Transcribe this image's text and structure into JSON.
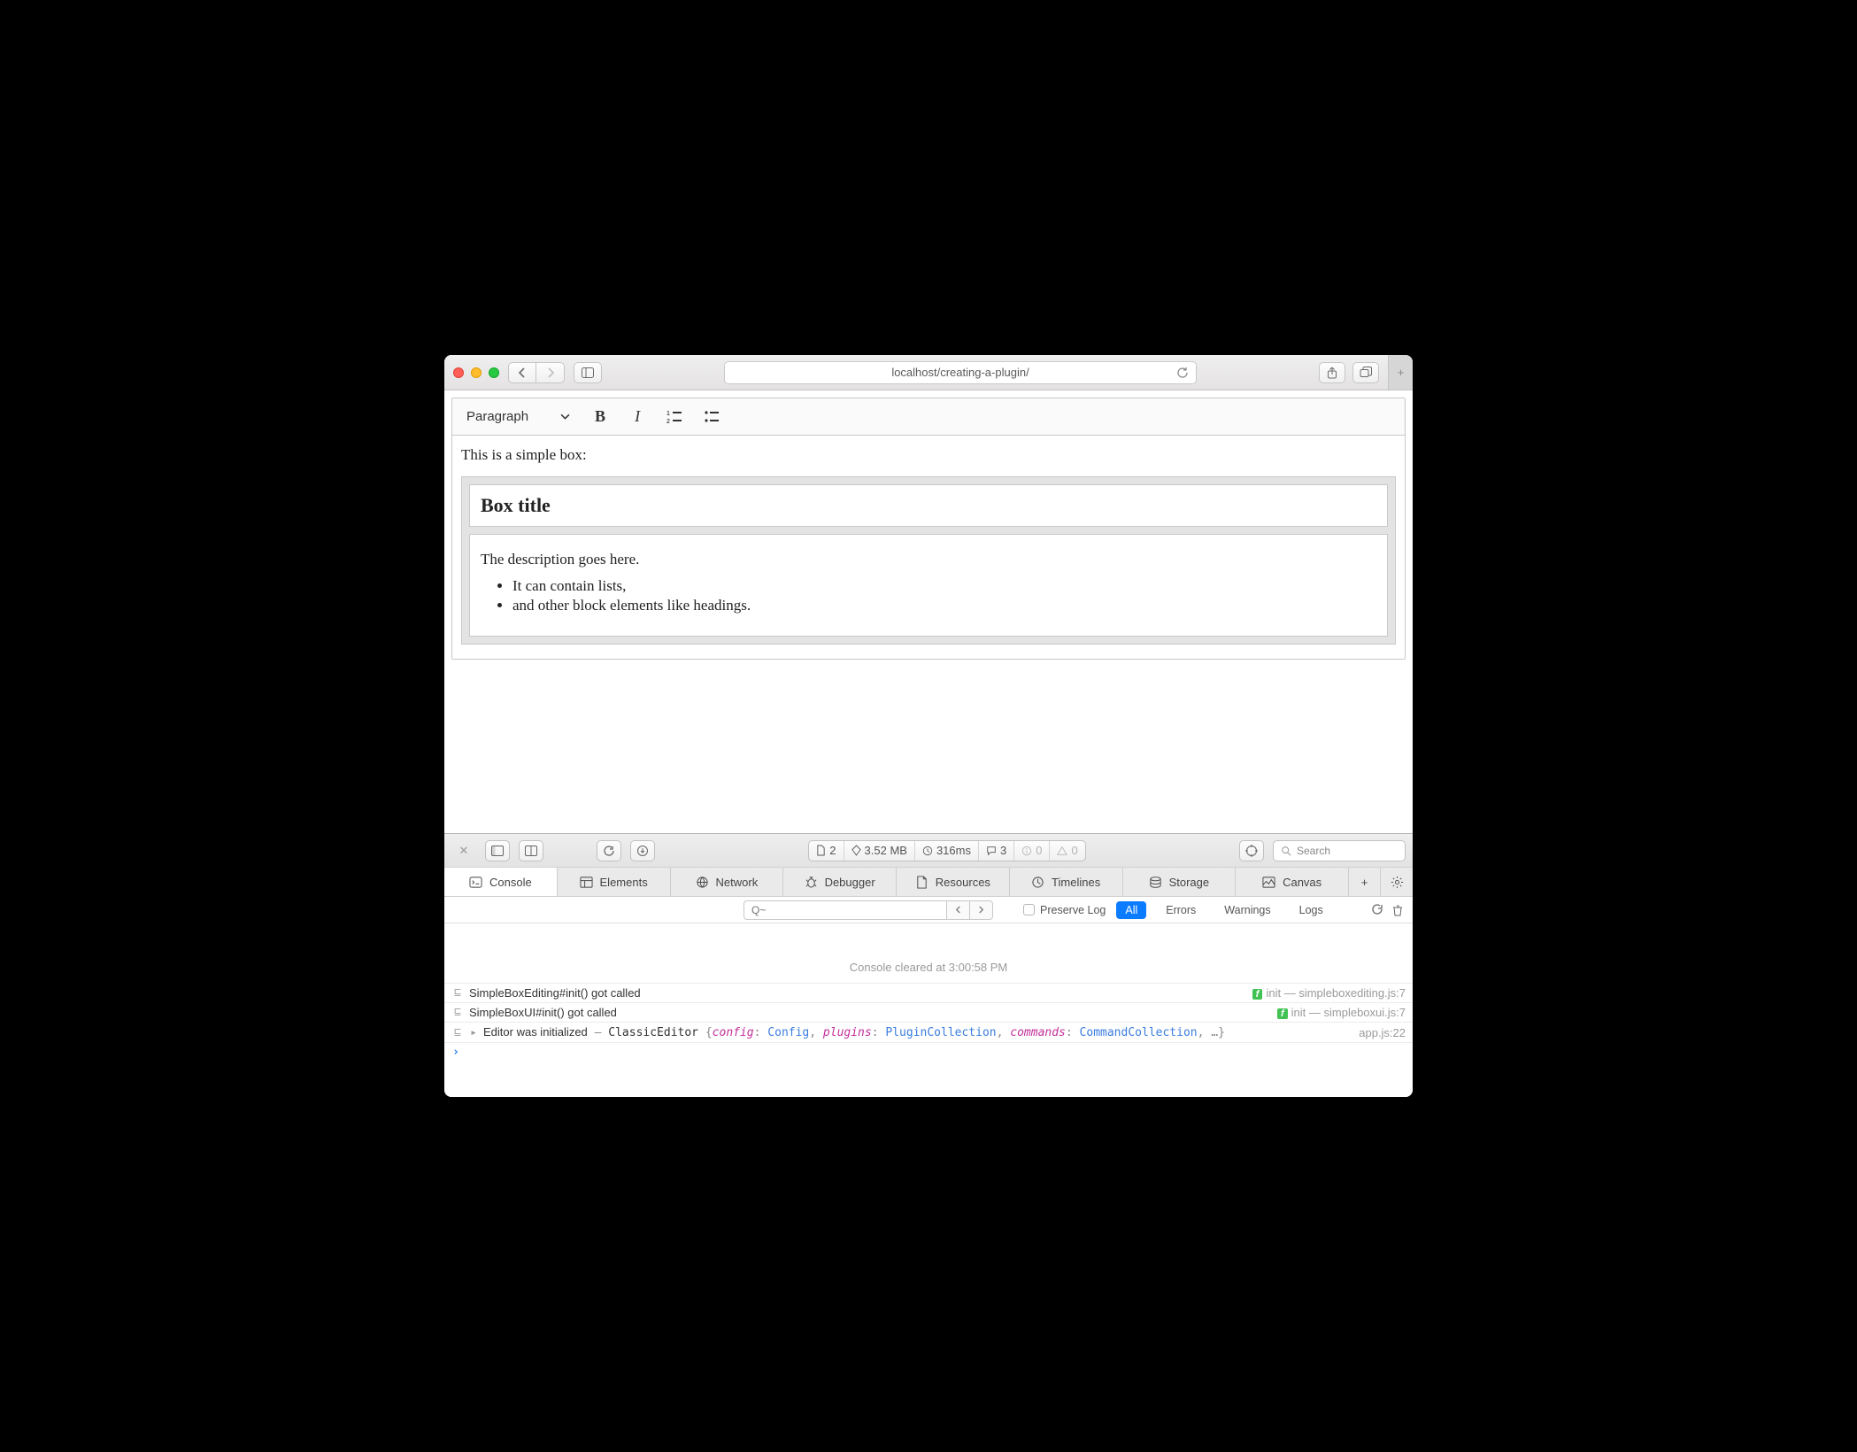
{
  "browser": {
    "url": "localhost/creating-a-plugin/"
  },
  "editor": {
    "heading_dropdown": "Paragraph",
    "intro": "This is a simple box:",
    "box_title": "Box title",
    "box_desc": "The description goes here.",
    "box_li1": "It can contain lists,",
    "box_li2": "and other block elements like headings."
  },
  "devtools": {
    "strip": {
      "docs": "2",
      "size": "3.52 MB",
      "time": "316ms",
      "comments": "3",
      "info": "0",
      "warn": "0",
      "search_placeholder": "Search"
    },
    "tabs": {
      "console": "Console",
      "elements": "Elements",
      "network": "Network",
      "debugger": "Debugger",
      "resources": "Resources",
      "timelines": "Timelines",
      "storage": "Storage",
      "canvas": "Canvas"
    },
    "filter": {
      "preserve": "Preserve Log",
      "all": "All",
      "errors": "Errors",
      "warnings": "Warnings",
      "logs": "Logs",
      "search_prefix": "Q~"
    },
    "console": {
      "cleared": "Console cleared at 3:00:58 PM",
      "row1": {
        "msg": "SimpleBoxEditing#init() got called",
        "fn": "init",
        "src": "simpleboxediting.js:7"
      },
      "row2": {
        "msg": "SimpleBoxUI#init() got called",
        "fn": "init",
        "src": "simpleboxui.js:7"
      },
      "row3": {
        "prefix": "Editor was initialized",
        "dash": "–",
        "cls": "ClassicEditor",
        "brace_open": "{",
        "k1": "config",
        "t1": "Config",
        "k2": "plugins",
        "t2": "PluginCollection",
        "k3": "commands",
        "t3": "CommandCollection",
        "ellipsis": ", …}",
        "src": "app.js:22"
      }
    }
  }
}
